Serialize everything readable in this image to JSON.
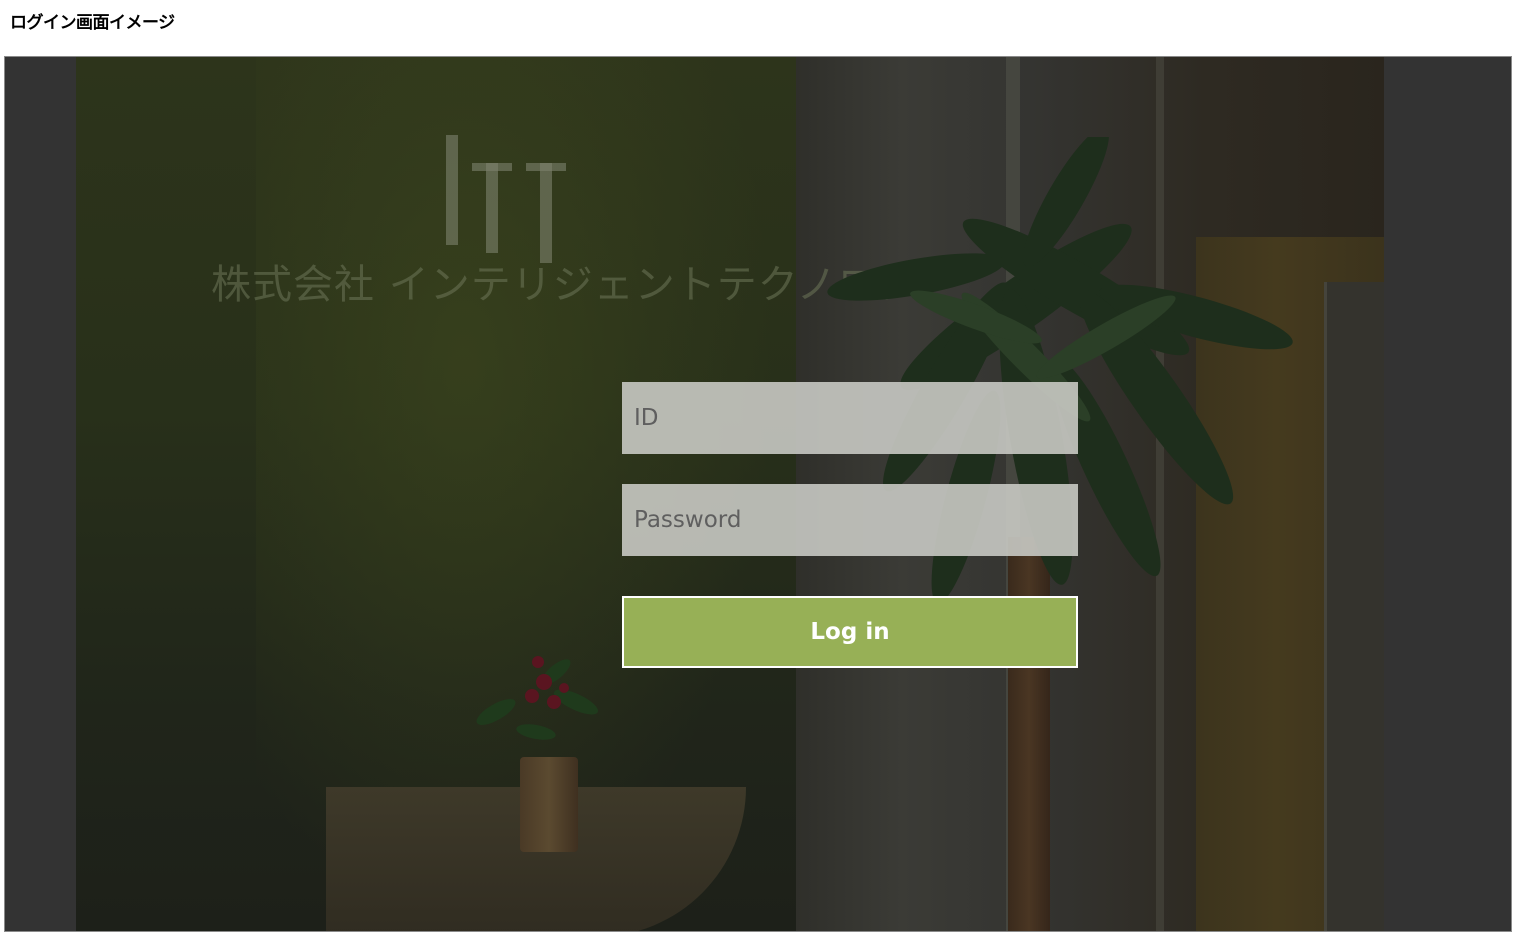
{
  "page": {
    "heading": "ログイン画面イメージ"
  },
  "login": {
    "id_placeholder": "ID",
    "password_placeholder": "Password",
    "submit_label": "Log in"
  },
  "background_photo": {
    "wall_sign": "株式会社 インテリジェントテクノロジー"
  },
  "colors": {
    "accent": "#97b056",
    "frame_background": "#333333",
    "input_background": "#c8c9c3",
    "button_border": "#ffffff"
  }
}
